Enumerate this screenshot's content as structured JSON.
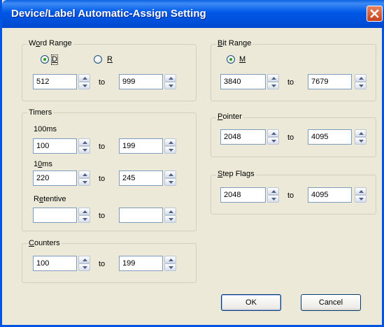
{
  "window": {
    "title": "Device/Label Automatic-Assign Setting"
  },
  "word_range": {
    "label_pre": "W",
    "label_u": "o",
    "label_post": "rd Range",
    "radio_d": {
      "label": "D",
      "selected": true
    },
    "radio_r": {
      "label": "R",
      "selected": false
    },
    "from": "512",
    "to_label": "to",
    "to": "999"
  },
  "timers": {
    "label": "Timers",
    "ms100": {
      "label": "100ms",
      "from": "100",
      "to": "199"
    },
    "ms10": {
      "label_pre": "1",
      "label_u": "0",
      "label_post": "ms",
      "from": "220",
      "to": "245"
    },
    "retentive": {
      "label_pre": "R",
      "label_u": "e",
      "label_post": "tentive",
      "from": "",
      "to": ""
    },
    "to_label": "to"
  },
  "counters": {
    "label_u": "C",
    "label_post": "ounters",
    "from": "100",
    "to_label": "to",
    "to": "199"
  },
  "bit_range": {
    "label_u": "B",
    "label_post": "it Range",
    "radio_m": {
      "label": "M",
      "selected": true
    },
    "from": "3840",
    "to_label": "to",
    "to": "7679"
  },
  "pointer": {
    "label_u": "P",
    "label_post": "ointer",
    "from": "2048",
    "to_label": "to",
    "to": "4095"
  },
  "step_flags": {
    "label_u": "S",
    "label_post": "tep Flags",
    "from": "2048",
    "to_label": "to",
    "to": "4095"
  },
  "buttons": {
    "ok": "OK",
    "cancel": "Cancel"
  }
}
